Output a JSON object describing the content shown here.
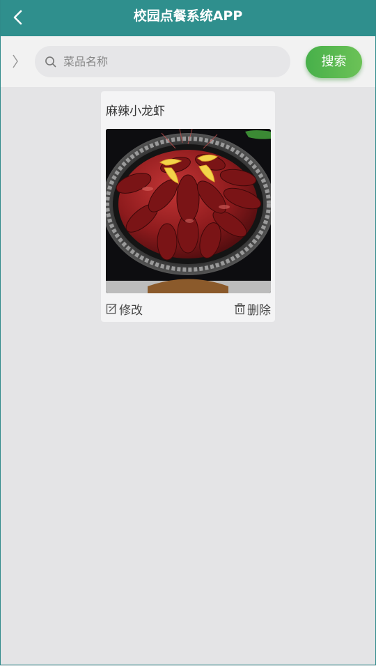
{
  "header": {
    "title": "校园点餐系统APP"
  },
  "search": {
    "placeholder": "菜品名称",
    "button_label": "搜索"
  },
  "items": [
    {
      "name": "麻辣小龙虾",
      "edit_label": "修改",
      "delete_label": "删除"
    }
  ],
  "colors": {
    "header_bg": "#2f8f8d",
    "search_button": "#4fb64c",
    "page_bg": "#e4e4e6"
  }
}
